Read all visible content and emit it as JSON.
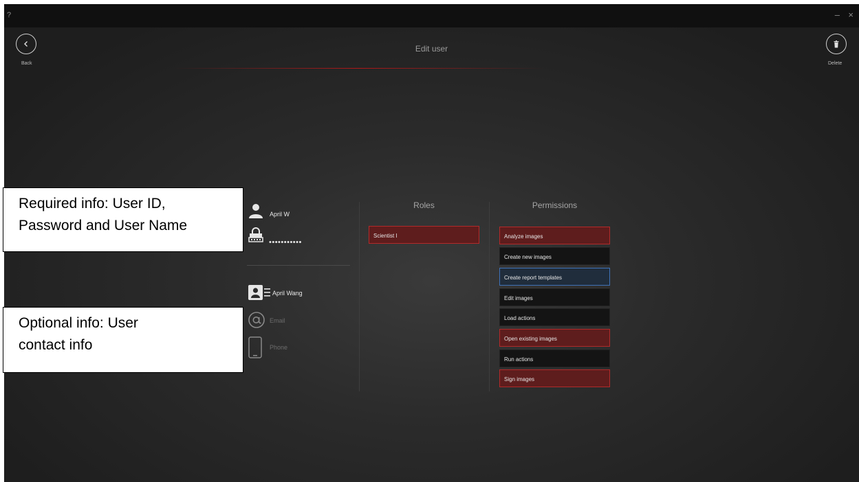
{
  "window": {
    "help_glyph": "?",
    "minimize_glyph": "–",
    "close_glyph": "×"
  },
  "header": {
    "title": "Edit user",
    "back_label": "Back",
    "delete_label": "Delete"
  },
  "user": {
    "user_id": "April W",
    "password_masked": "•••••••••••",
    "user_name": "April Wang",
    "email_placeholder": "Email",
    "phone_placeholder": "Phone"
  },
  "roles": {
    "heading": "Roles",
    "items": [
      {
        "label": "Scientist I",
        "state": "selected"
      }
    ]
  },
  "permissions": {
    "heading": "Permissions",
    "items": [
      {
        "label": "Analyze images",
        "state": "granted"
      },
      {
        "label": "Create new images",
        "state": "none"
      },
      {
        "label": "Create report templates",
        "state": "focused"
      },
      {
        "label": "Edit images",
        "state": "none"
      },
      {
        "label": "Load actions",
        "state": "none"
      },
      {
        "label": "Open existing images",
        "state": "granted"
      },
      {
        "label": "Run actions",
        "state": "none"
      },
      {
        "label": "Sign images",
        "state": "granted"
      }
    ]
  },
  "annotations": {
    "required": [
      "Required info: User ID,",
      "Password and User Name"
    ],
    "optional": [
      "Optional info: User",
      "contact info"
    ]
  },
  "colors": {
    "accent_red": "#b22a2a",
    "focus_blue": "#3f72b8",
    "background": "#2b2b2b"
  },
  "icons": {
    "back": "chevron-left-icon",
    "delete": "trash-icon",
    "user_id": "person-icon",
    "password": "lock-keypad-icon",
    "user_name": "id-card-icon",
    "email": "at-sign-icon",
    "phone": "phone-icon"
  }
}
